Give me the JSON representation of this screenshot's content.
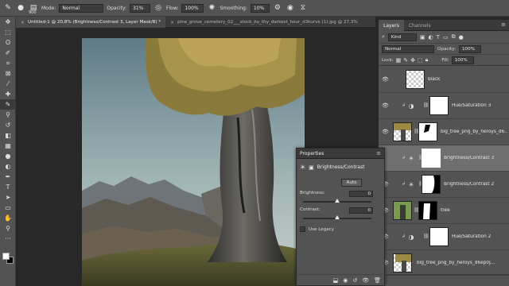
{
  "options_bar": {
    "brush_size": "900",
    "mode_label": "Mode:",
    "mode_value": "Normal",
    "opacity_label": "Opacity:",
    "opacity_value": "31%",
    "flow_label": "Flow:",
    "flow_value": "100%",
    "smoothing_label": "Smoothing:",
    "smoothing_value": "10%"
  },
  "doc_tabs": [
    {
      "label": "Untitled-1 @ 20,8% (Brightness/Contrast 3, Layer Mask/8) *",
      "active": true
    },
    {
      "label": "pine_grove_cemetery_02___stock_by_thy_darkest_hour_d3kurvx (1).jpg @ 27,3%",
      "active": false
    }
  ],
  "panel_tabs": [
    {
      "label": "Layers",
      "active": true
    },
    {
      "label": "Channels",
      "active": false
    }
  ],
  "layers_panel": {
    "filter_kind": "Kind",
    "blend_mode": "Normal",
    "opacity_label": "Opacity:",
    "opacity_value": "100%",
    "lock_label": "Lock:",
    "fill_label": "Fill:",
    "fill_value": "100%",
    "layers": [
      {
        "name": "black",
        "type": "pixel",
        "visible": true,
        "clipped": false,
        "selected": false
      },
      {
        "name": "Hue/Saturation 3",
        "type": "adjustment",
        "visible": true,
        "clipped": true,
        "selected": false
      },
      {
        "name": "big_tree_png_by_heroys_d6...",
        "type": "smart",
        "visible": true,
        "clipped": false,
        "selected": false
      },
      {
        "name": "Brightness/Contrast 3",
        "type": "adjustment",
        "visible": false,
        "clipped": true,
        "selected": true
      },
      {
        "name": "Brightness/Contrast 2",
        "type": "adjustment",
        "visible": true,
        "clipped": true,
        "selected": false
      },
      {
        "name": "tree",
        "type": "pixel",
        "visible": true,
        "clipped": false,
        "selected": false
      },
      {
        "name": "Hue/Saturation 2",
        "type": "adjustment",
        "visible": true,
        "clipped": true,
        "selected": false
      },
      {
        "name": "big_tree_png_by_heroys_d6ep0j...",
        "type": "smart",
        "visible": true,
        "clipped": false,
        "selected": false
      }
    ]
  },
  "properties": {
    "title": "Properties",
    "adjustment_name": "Brightness/Contrast",
    "auto_label": "Auto",
    "brightness_label": "Brightness:",
    "brightness_value": "0",
    "contrast_label": "Contrast:",
    "contrast_value": "0",
    "legacy_label": "Use Legacy"
  },
  "colors": {
    "accent_selected": "#6f6f6f",
    "panel_bg": "#535353",
    "canvas_bg": "#282828"
  }
}
